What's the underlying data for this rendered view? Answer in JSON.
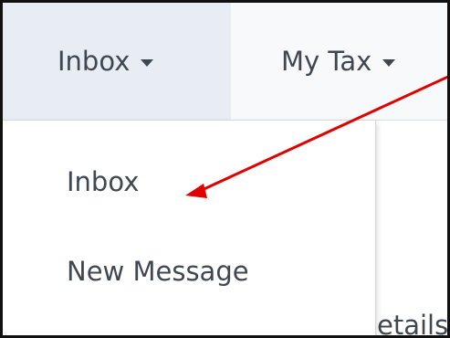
{
  "nav": {
    "tabs": [
      {
        "label": "Inbox",
        "icon": "caret-down-icon"
      },
      {
        "label": "My Tax",
        "icon": "caret-down-icon"
      }
    ]
  },
  "dropdown": {
    "items": [
      {
        "label": "Inbox"
      },
      {
        "label": "New Message"
      }
    ]
  },
  "background": {
    "partial_text": "etails"
  },
  "annotation": {
    "arrow_color": "#e00000"
  }
}
